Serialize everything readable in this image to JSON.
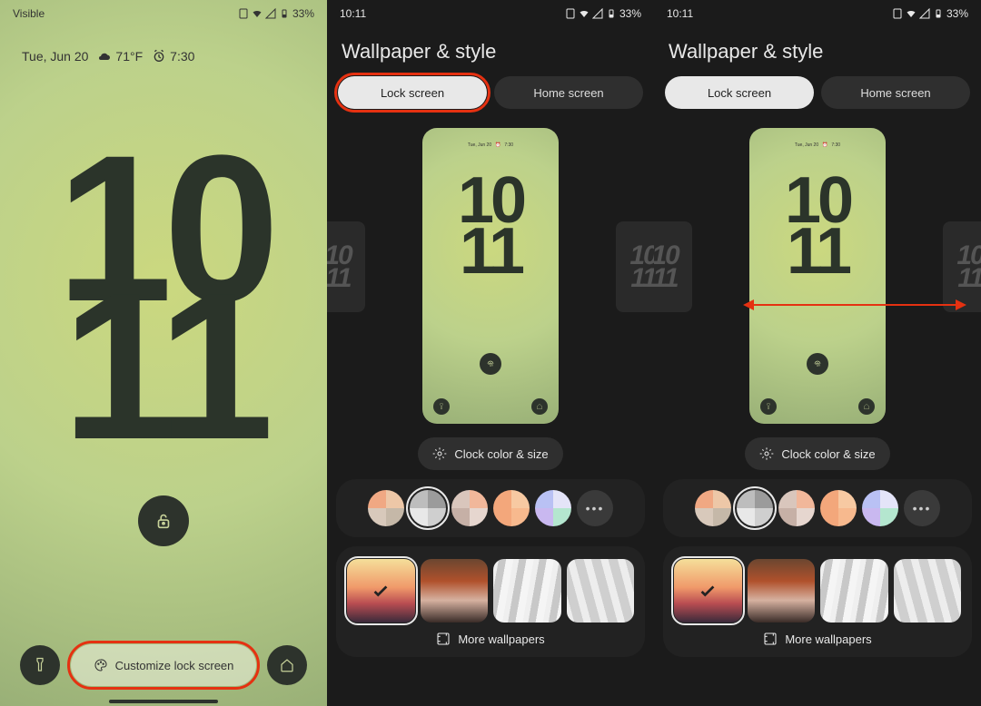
{
  "status": {
    "carrier": "Visible",
    "time": "10:11",
    "battery_pct": "33%"
  },
  "lockscreen": {
    "date": "Tue, Jun 20",
    "temp": "71°F",
    "alarm": "7:30",
    "clock_top": "10",
    "clock_bottom": "11",
    "customize_label": "Customize lock screen"
  },
  "settings": {
    "title": "Wallpaper & style",
    "tab_lock": "Lock screen",
    "tab_home": "Home screen",
    "clock_chip": "Clock color & size",
    "more_wallpapers": "More wallpapers",
    "preview": {
      "date": "Tue, Jun 20",
      "alarm": "7:30",
      "clock_top": "10",
      "clock_bottom": "11",
      "side_top": "10",
      "side_bottom": "11"
    },
    "swatches": [
      {
        "c": [
          "#f0a883",
          "#edc7a7",
          "#d8c9bb",
          "#c5b8a8"
        ],
        "selected": false
      },
      {
        "c": [
          "#bdbdbd",
          "#9b9b9b",
          "#e8e8e8",
          "#cfcfcf"
        ],
        "selected": true
      },
      {
        "c": [
          "#d9c6bc",
          "#f1b79a",
          "#c6b0a6",
          "#e6d6cf"
        ],
        "selected": false
      },
      {
        "c": [
          "#f3a77b",
          "#f7c9a2",
          "#f3a77b",
          "#f7b98e"
        ],
        "selected": false
      },
      {
        "c": [
          "#b9c1f4",
          "#e4e4f8",
          "#c9b8f0",
          "#b4e6cf"
        ],
        "selected": false
      }
    ],
    "wallpapers": [
      {
        "css": "linear-gradient(180deg,#f5df9a 0%,#f0996a 45%,#b94d52 70%,#3a2a3a 100%)",
        "selected": true
      },
      {
        "css": "linear-gradient(180deg,#6b4630 0%, #b0512c 35%, #d6b1a0 65%, #3a2c28 100%)",
        "selected": false
      },
      {
        "css": "repeating-linear-gradient(100deg,#efefef 0 6px,#c8c8c8 6px 14px,#f5f5f5 14px 22px)",
        "selected": false
      },
      {
        "css": "repeating-linear-gradient(75deg,#ededed 0 8px,#cfcfcf 8px 18px)",
        "selected": false
      }
    ]
  }
}
